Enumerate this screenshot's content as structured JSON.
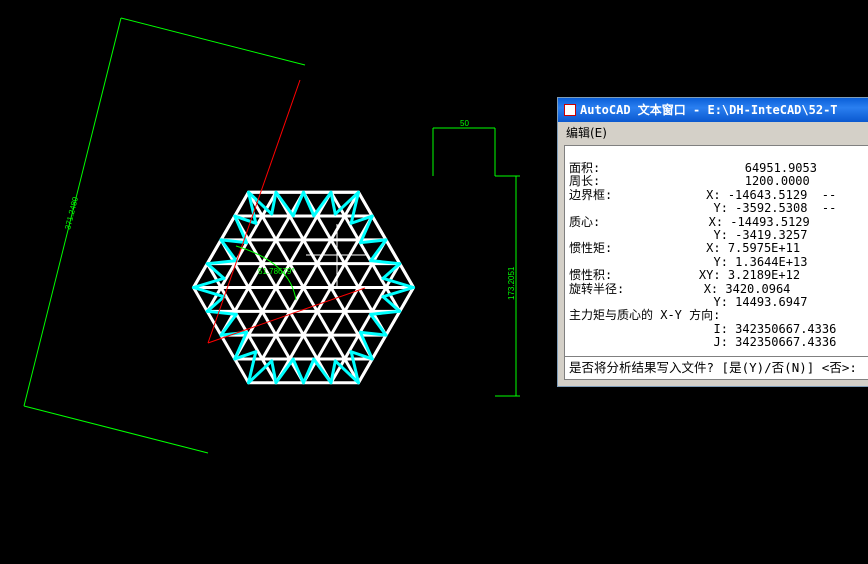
{
  "drawing": {
    "dimension_top": "50",
    "dimension_right": "173.2051",
    "dimension_left": "371.2480",
    "angle_label": "51.78679°",
    "colors": {
      "background": "#000000",
      "outline": "#ffffff",
      "highlight": "#00ffff",
      "dimension": "#00ff00",
      "construction": "#ff0000"
    }
  },
  "text_window": {
    "title": "AutoCAD 文本窗口 - E:\\DH-InteCAD\\52-T",
    "menu": [
      "编辑(E)"
    ],
    "lines": [
      "面积:                    64951.9053",
      "周长:                    1200.0000",
      "边界框:             X: -14643.5129  --",
      "                    Y: -3592.5308  --",
      "质心:               X: -14493.5129",
      "                    Y: -3419.3257",
      "惯性矩:             X: 7.5975E+11",
      "                    Y: 1.3644E+13",
      "惯性积:            XY: 3.2189E+12",
      "旋转半径:           X: 3420.0964",
      "                    Y: 14493.6947",
      "主力矩与质心的 X-Y 方向:",
      "                    I: 342350667.4336",
      "                    J: 342350667.4336"
    ],
    "prompt": "是否将分析结果写入文件? [是(Y)/否(N)] <否>:"
  }
}
